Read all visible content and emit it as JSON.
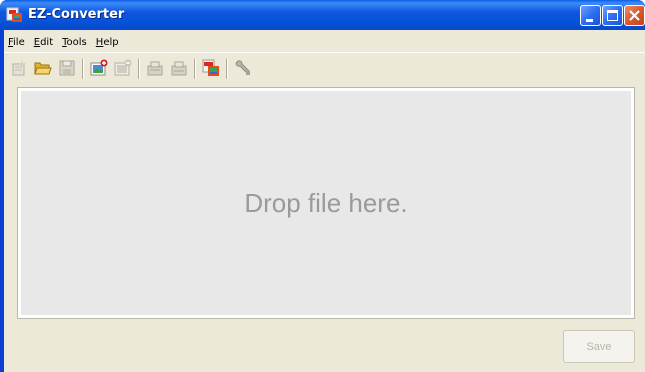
{
  "window": {
    "title": "EZ-Converter"
  },
  "menu": {
    "items": [
      {
        "underline": "F",
        "rest": "ile"
      },
      {
        "underline": "E",
        "rest": "dit"
      },
      {
        "underline": "T",
        "rest": "ools"
      },
      {
        "underline": "H",
        "rest": "elp"
      }
    ]
  },
  "toolbar": {
    "icons": [
      "new-file-icon",
      "open-folder-icon",
      "save-disk-icon",
      "add-image-icon",
      "remove-image-icon",
      "export-icon",
      "import-icon",
      "convert-icon",
      "settings-wrench-icon"
    ]
  },
  "drop_zone": {
    "text": "Drop file here."
  },
  "buttons": {
    "save_label": "Save"
  },
  "colors": {
    "titlebar": "#0552d8",
    "client_bg": "#ece9d8",
    "drop_bg": "#e8e8e8",
    "drop_text": "#9a9a9a"
  }
}
